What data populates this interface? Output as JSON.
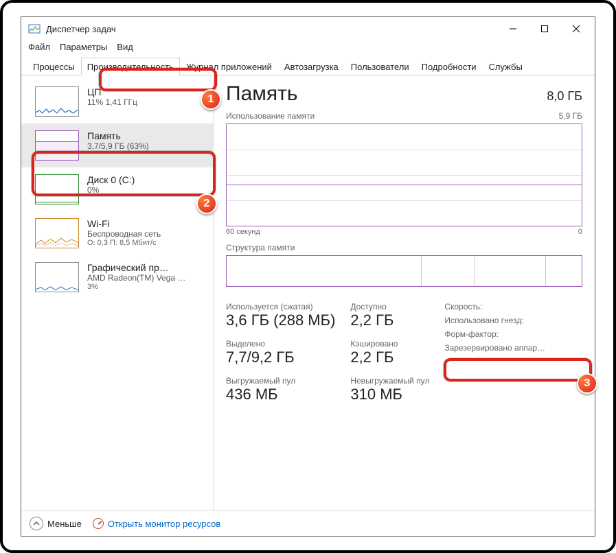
{
  "title": "Диспетчер задач",
  "menu": {
    "file": "Файл",
    "options": "Параметры",
    "view": "Вид"
  },
  "tabs": {
    "processes": "Процессы",
    "performance": "Производительность",
    "app_history": "Журнал приложений",
    "startup": "Автозагрузка",
    "users": "Пользователи",
    "details": "Подробности",
    "services": "Службы"
  },
  "sidebar": {
    "cpu": {
      "title": "ЦП",
      "sub": "11% 1,41 ГГц"
    },
    "mem": {
      "title": "Память",
      "sub": "3,7/5,9 ГБ (63%)"
    },
    "disk": {
      "title": "Диск 0 (C:)",
      "sub": "0%"
    },
    "wifi": {
      "title": "Wi-Fi",
      "sub": "Беспроводная сеть",
      "sub2": "О: 0,3 П: 8,5 Мбит/с"
    },
    "gpu": {
      "title": "Графический пр…",
      "sub": "AMD Radeon(TM) Vega …",
      "sub2": "3%"
    }
  },
  "main": {
    "heading": "Память",
    "total": "8,0 ГБ",
    "usage_label": "Использование памяти",
    "usage_max": "5,9 ГБ",
    "x_left": "60 секунд",
    "x_right": "0",
    "comp_label": "Структура памяти",
    "stats": {
      "in_use_lab": "Используется (сжатая)",
      "in_use_val": "3,6 ГБ (288 МБ)",
      "avail_lab": "Доступно",
      "avail_val": "2,2 ГБ",
      "commit_lab": "Выделено",
      "commit_val": "7,7/9,2 ГБ",
      "cached_lab": "Кэшировано",
      "cached_val": "2,2 ГБ",
      "ppool_lab": "Выгружаемый пул",
      "ppool_val": "436 МБ",
      "npool_lab": "Невыгружаемый пул",
      "npool_val": "310 МБ"
    },
    "right": {
      "speed": "Скорость:",
      "slots": "Использовано гнезд:",
      "form": "Форм-фактор:",
      "hw": "Зарезервировано аппар…"
    }
  },
  "footer": {
    "fewer": "Меньше",
    "monitor": "Открыть монитор ресурсов"
  },
  "chart_data": {
    "type": "area",
    "title": "Использование памяти",
    "ylabel": "ГБ",
    "ylim": [
      0,
      5.9
    ],
    "x_range_seconds": [
      60,
      0
    ],
    "series": [
      {
        "name": "Память",
        "approx_current_gb": 3.7,
        "approx_percent": 63
      }
    ],
    "composition_segments_percent": [
      55,
      15,
      20,
      10
    ]
  },
  "annotations": {
    "b1": "1",
    "b2": "2",
    "b3": "3"
  }
}
